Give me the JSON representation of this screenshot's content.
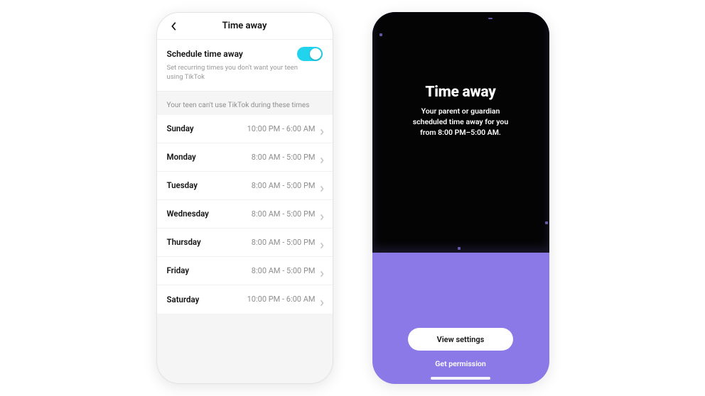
{
  "phone_left": {
    "header_title": "Time away",
    "card": {
      "title": "Schedule time away",
      "description": "Set recurring times you don't want your teen using TikTok",
      "toggle_on": true
    },
    "section_header": "Your teen can't use TikTok during these times",
    "schedule": [
      {
        "day": "Sunday",
        "range": "10:00 PM - 6:00 AM"
      },
      {
        "day": "Monday",
        "range": "8:00 AM - 5:00 PM"
      },
      {
        "day": "Tuesday",
        "range": "8:00 AM - 5:00 PM"
      },
      {
        "day": "Wednesday",
        "range": "8:00 AM - 5:00 PM"
      },
      {
        "day": "Thursday",
        "range": "8:00 AM - 5:00 PM"
      },
      {
        "day": "Friday",
        "range": "8:00 AM - 5:00 PM"
      },
      {
        "day": "Saturday",
        "range": "10:00 PM - 6:00 AM"
      }
    ]
  },
  "phone_right": {
    "title": "Time away",
    "description_line1": "Your parent or guardian",
    "description_line2": "scheduled time away for you",
    "description_line3": "from 8:00 PM–5:00 AM.",
    "primary_button": "View settings",
    "secondary_link": "Get permission"
  },
  "icons": {
    "back": "chevron-left-icon",
    "row_chevron": "chevron-right-icon"
  },
  "colors": {
    "toggle_on": "#22d3ee",
    "purple": "#8a79e6"
  }
}
